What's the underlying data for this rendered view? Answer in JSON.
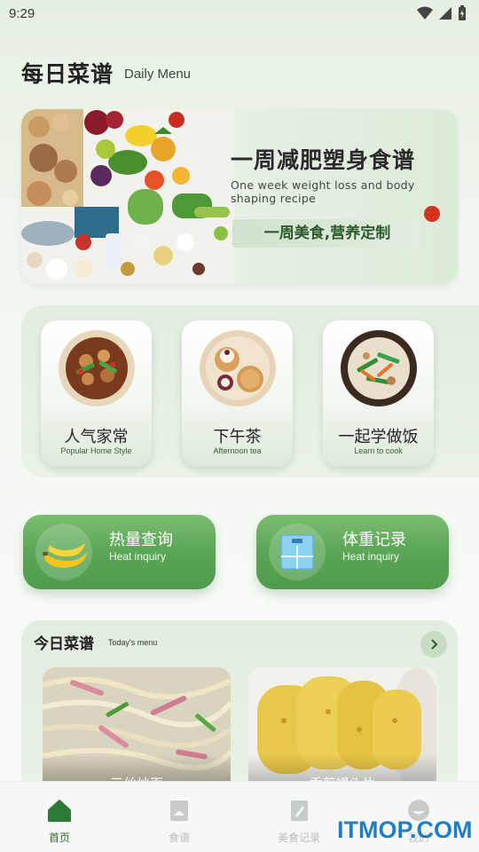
{
  "status_bar": {
    "time": "9:29"
  },
  "header": {
    "title": "每日菜谱",
    "subtitle": "Daily Menu"
  },
  "banner": {
    "title": "一周减肥塑身食谱",
    "subtitle_en": "One week weight loss and body shaping recipe",
    "tag": "一周美食,营养定制"
  },
  "categories": [
    {
      "label": "人气家常",
      "sublabel": "Popular Home Style"
    },
    {
      "label": "下午茶",
      "sublabel": "Afternoon tea"
    },
    {
      "label": "一起学做饭",
      "sublabel": "Learn to cook"
    }
  ],
  "tools": [
    {
      "label": "热量查询",
      "sublabel": "Heat inquiry",
      "icon": "banana-icon"
    },
    {
      "label": "体重记录",
      "sublabel": "Heat inquiry",
      "icon": "scale-icon"
    }
  ],
  "today": {
    "title": "今日菜谱",
    "subtitle": "Today's menu",
    "dishes": [
      {
        "name": "三丝炒面"
      },
      {
        "name": "香煎馒头片"
      }
    ]
  },
  "tab_bar": {
    "items": [
      {
        "label": "首页",
        "icon": "home-icon",
        "active": true
      },
      {
        "label": "食谱",
        "icon": "recipe-book-icon",
        "active": false
      },
      {
        "label": "美食记录",
        "icon": "notebook-icon",
        "active": false
      },
      {
        "label": "我的",
        "icon": "profile-icon",
        "active": false
      }
    ]
  },
  "watermark": "ITMOP.COM",
  "colors": {
    "accent_green": "#5ca857",
    "active_tab": "#2c6b34",
    "inactive_tab": "#b9bdb9"
  }
}
